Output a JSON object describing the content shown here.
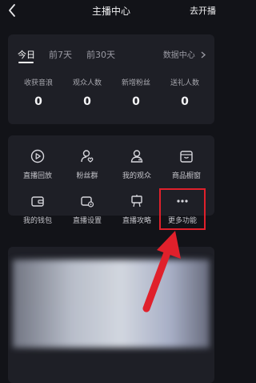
{
  "header": {
    "title": "主播中心",
    "action": "去开播"
  },
  "stats_card": {
    "tabs": [
      {
        "label": "今日"
      },
      {
        "label": "前7天"
      },
      {
        "label": "前30天"
      }
    ],
    "data_center_label": "数据中心",
    "metrics": [
      {
        "label": "收获音浪",
        "value": "0"
      },
      {
        "label": "观众人数",
        "value": "0"
      },
      {
        "label": "新增粉丝",
        "value": "0"
      },
      {
        "label": "送礼人数",
        "value": "0"
      }
    ]
  },
  "tools": [
    {
      "label": "直播回放",
      "icon": "replay-icon"
    },
    {
      "label": "粉丝群",
      "icon": "fan-group-icon"
    },
    {
      "label": "我的观众",
      "icon": "audience-icon"
    },
    {
      "label": "商品橱窗",
      "icon": "shop-window-icon"
    },
    {
      "label": "我的钱包",
      "icon": "wallet-icon"
    },
    {
      "label": "直播设置",
      "icon": "live-settings-icon"
    },
    {
      "label": "直播攻略",
      "icon": "guide-icon"
    },
    {
      "label": "更多功能",
      "icon": "more-icon"
    }
  ],
  "colors": {
    "background": "#121318",
    "card": "#1e1f26",
    "highlight": "#e0202b"
  }
}
